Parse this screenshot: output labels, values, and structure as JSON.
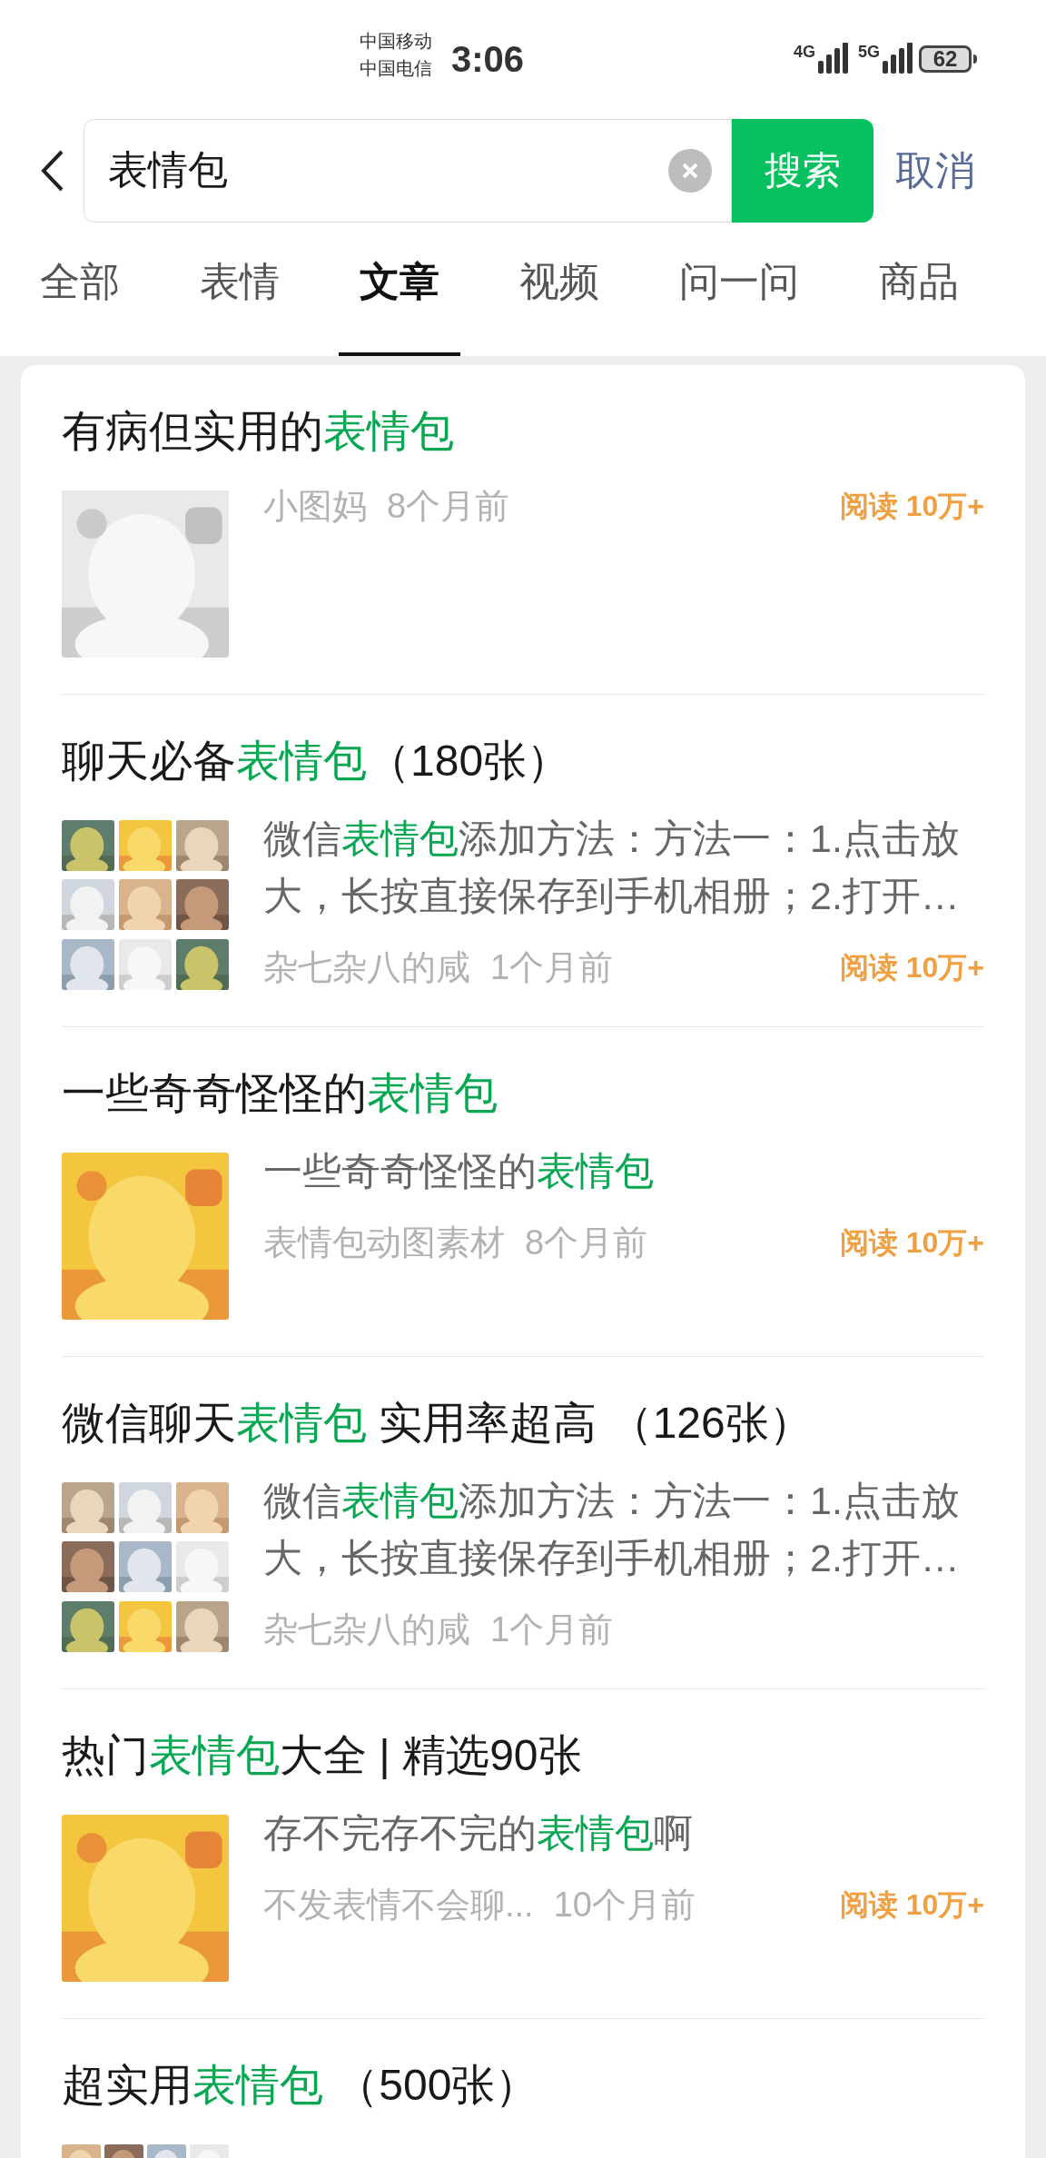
{
  "status_bar": {
    "carriers": [
      "中国移动",
      "中国电信"
    ],
    "time": "3:06",
    "networks": [
      "4G",
      "5G"
    ],
    "battery": "62"
  },
  "search": {
    "value": "表情包",
    "button": "搜索",
    "cancel": "取消"
  },
  "tabs": [
    {
      "label": "全部",
      "selected": false
    },
    {
      "label": "表情",
      "selected": false
    },
    {
      "label": "文章",
      "selected": true
    },
    {
      "label": "视频",
      "selected": false
    },
    {
      "label": "问一问",
      "selected": false
    },
    {
      "label": "商品",
      "selected": false
    }
  ],
  "articles": [
    {
      "kind": "single",
      "title": [
        {
          "text": "有病但实用的",
          "hl": false
        },
        {
          "text": "表情包",
          "hl": true
        }
      ],
      "author": "小图妈",
      "time": "8个月前",
      "reads": "阅读 10万+"
    },
    {
      "kind": "grid3",
      "title": [
        {
          "text": "聊天必备",
          "hl": false
        },
        {
          "text": "表情包",
          "hl": true
        },
        {
          "text": "（180张）",
          "hl": false
        }
      ],
      "desc": [
        {
          "text": "微信",
          "hl": false
        },
        {
          "text": "表情包",
          "hl": true
        },
        {
          "text": "添加方法：方法一：1.点击放大，长按直接保存到手机相册；2.打开…",
          "hl": false
        }
      ],
      "author": "杂七杂八的咸",
      "time": "1个月前",
      "reads": "阅读 10万+"
    },
    {
      "kind": "single",
      "title": [
        {
          "text": "一些奇奇怪怪的",
          "hl": false
        },
        {
          "text": "表情包",
          "hl": true
        }
      ],
      "desc": [
        {
          "text": "一些奇奇怪怪的",
          "hl": false
        },
        {
          "text": "表情包",
          "hl": true
        }
      ],
      "author": "表情包动图素材",
      "time": "8个月前",
      "reads": "阅读 10万+"
    },
    {
      "kind": "grid3",
      "title": [
        {
          "text": "微信聊天",
          "hl": false
        },
        {
          "text": "表情包",
          "hl": true
        },
        {
          "text": " 实用率超高 （126张）",
          "hl": false
        }
      ],
      "desc": [
        {
          "text": "微信",
          "hl": false
        },
        {
          "text": "表情包",
          "hl": true
        },
        {
          "text": "添加方法：方法一：1.点击放大，长按直接保存到手机相册；2.打开…",
          "hl": false
        }
      ],
      "author": "杂七杂八的咸",
      "time": "1个月前"
    },
    {
      "kind": "single",
      "title": [
        {
          "text": "热门",
          "hl": false
        },
        {
          "text": "表情包",
          "hl": true
        },
        {
          "text": "大全 | 精选90张",
          "hl": false
        }
      ],
      "desc": [
        {
          "text": "存不完存不完的",
          "hl": false
        },
        {
          "text": "表情包",
          "hl": true
        },
        {
          "text": "啊",
          "hl": false
        }
      ],
      "author": "不发表情不会聊...",
      "time": "10个月前",
      "reads": "阅读 10万+"
    },
    {
      "kind": "grid4",
      "title": [
        {
          "text": "超实用",
          "hl": false
        },
        {
          "text": "表情包",
          "hl": true
        },
        {
          "text": " （500张）",
          "hl": false
        }
      ]
    }
  ]
}
